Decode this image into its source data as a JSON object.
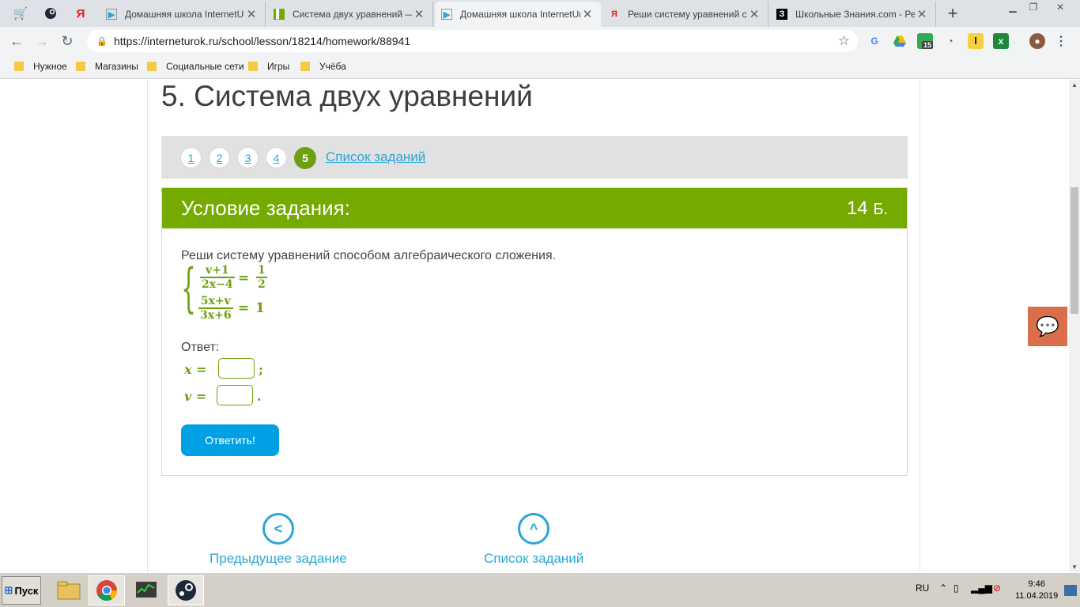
{
  "tabs": [
    {
      "title": "Домашняя школа InternetUro",
      "active": false,
      "favicon": "play-icon"
    },
    {
      "title": "Система двух уравнений — з",
      "active": false,
      "favicon": "green-grid-icon"
    },
    {
      "title": "Домашняя школа InternetUro",
      "active": true,
      "favicon": "play-icon"
    },
    {
      "title": "Реши систему уравнений спо",
      "active": false,
      "favicon": "yandex-icon"
    },
    {
      "title": "Школьные Знания.com - Реш",
      "active": false,
      "favicon": "znanija-icon"
    }
  ],
  "pinned": {
    "yandex": "Я"
  },
  "address": {
    "url": "https://interneturok.ru/school/lesson/18214/homework/88941"
  },
  "extensions": {
    "badge": "15"
  },
  "bookmarks": [
    "Нужное",
    "Магазины",
    "Социальные сети",
    "Игры",
    "Учёба"
  ],
  "page": {
    "title": "5. Система двух уравнений",
    "pages": [
      "1",
      "2",
      "3",
      "4",
      "5"
    ],
    "current_page": "5",
    "task_list_link": "Список заданий",
    "card_title": "Условие задания:",
    "points": "14",
    "points_unit": "Б.",
    "task_text": "Реши систему уравнений способом алгебраического сложения.",
    "eq1": {
      "num": "v+1",
      "den": "2x−4",
      "rhs_num": "1",
      "rhs_den": "2",
      "eq": "="
    },
    "eq2": {
      "num": "5x+v",
      "den": "3x+6",
      "rhs": "1",
      "eq": "="
    },
    "answer_label": "Ответ:",
    "var1": "x =",
    "var1_punct": ";",
    "var2": "v =",
    "var2_punct": ".",
    "submit": "Ответить!",
    "prev_task": "Предыдущее задание",
    "bottom_task_list": "Список заданий"
  },
  "taskbar": {
    "start": "Пуск",
    "lang": "RU",
    "time": "9:46",
    "date": "11.04.2019"
  },
  "colors": {
    "accent_green": "#75aa00",
    "link_blue": "#2aa6d5",
    "button_blue": "#00a1e4",
    "chat_orange": "#d96e4a"
  }
}
